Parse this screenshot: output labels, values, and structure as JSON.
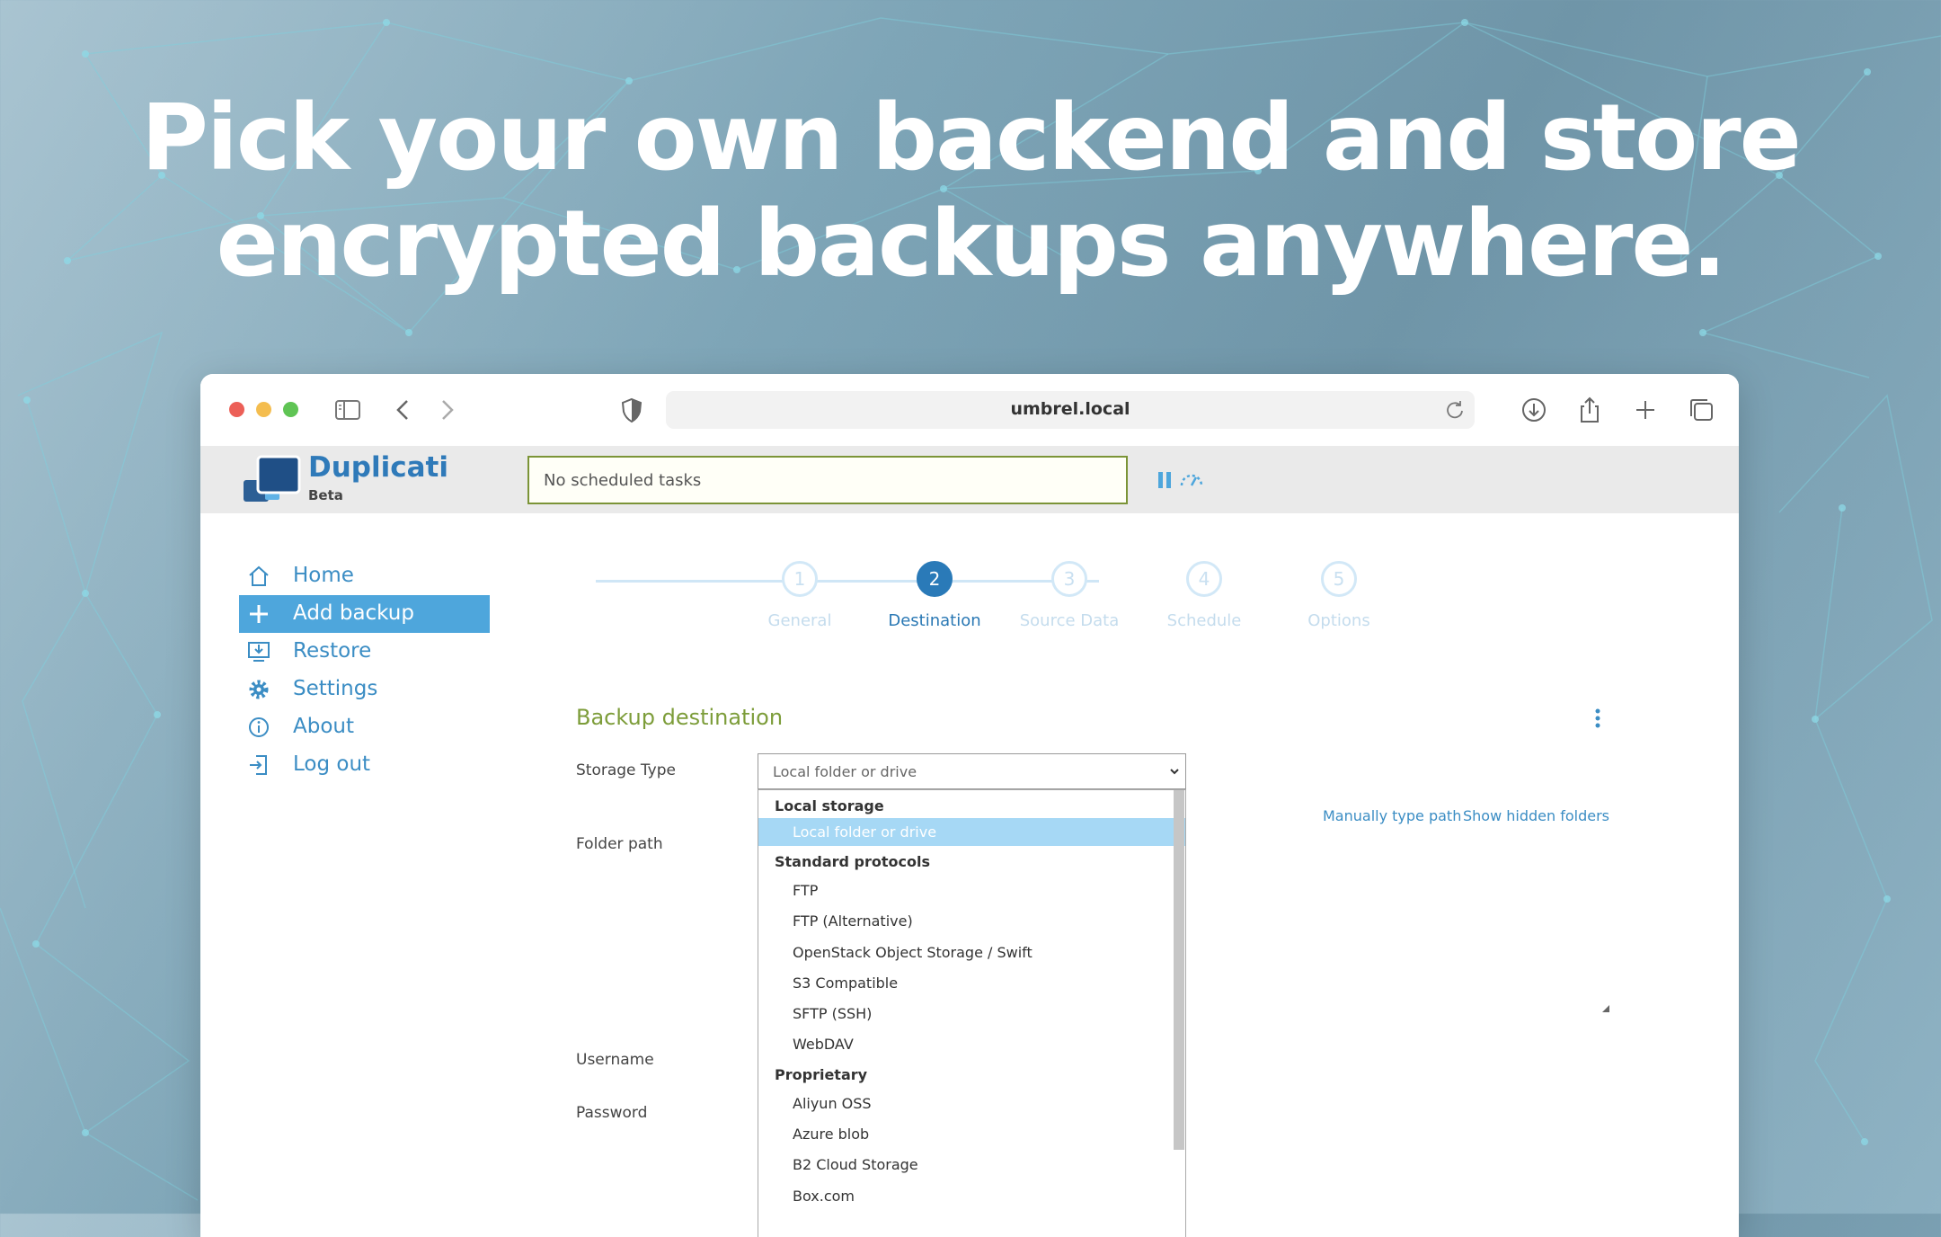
{
  "headline": {
    "line1": "Pick your own backend and store",
    "line2": "encrypted backups anywhere."
  },
  "browser": {
    "url": "umbrel.local"
  },
  "app": {
    "brand": "Duplicati",
    "brand_sub": "Beta",
    "task_status": "No scheduled tasks"
  },
  "sidebar": {
    "items": [
      {
        "label": "Home",
        "icon": "home-icon"
      },
      {
        "label": "Add backup",
        "icon": "plus-icon"
      },
      {
        "label": "Restore",
        "icon": "restore-icon"
      },
      {
        "label": "Settings",
        "icon": "gear-icon"
      },
      {
        "label": "About",
        "icon": "info-icon"
      },
      {
        "label": "Log out",
        "icon": "logout-icon"
      }
    ],
    "active_index": 1
  },
  "steps": [
    {
      "number": "1",
      "label": "General"
    },
    {
      "number": "2",
      "label": "Destination"
    },
    {
      "number": "3",
      "label": "Source Data"
    },
    {
      "number": "4",
      "label": "Schedule"
    },
    {
      "number": "5",
      "label": "Options"
    }
  ],
  "active_step": 2,
  "form": {
    "section_title": "Backup destination",
    "storage_type_label": "Storage Type",
    "storage_type_value": "Local folder or drive",
    "folder_path_label": "Folder path",
    "username_label": "Username",
    "password_label": "Password",
    "manual_path_link": "Manually type path",
    "hidden_folders_link": "Show hidden folders"
  },
  "dropdown": {
    "groups": [
      {
        "name": "Local storage",
        "options": [
          "Local folder or drive"
        ]
      },
      {
        "name": "Standard protocols",
        "options": [
          "FTP",
          "FTP (Alternative)",
          "OpenStack Object Storage / Swift",
          "S3 Compatible",
          "SFTP (SSH)",
          "WebDAV"
        ]
      },
      {
        "name": "Proprietary",
        "options": [
          "Aliyun OSS",
          "Azure blob",
          "B2 Cloud Storage",
          "Box.com"
        ]
      }
    ],
    "selected": "Local folder or drive"
  },
  "colors": {
    "accent": "#4ea6dc",
    "link": "#3b8dc4",
    "section_title": "#7d9d3a",
    "task_border": "#7b9437"
  }
}
